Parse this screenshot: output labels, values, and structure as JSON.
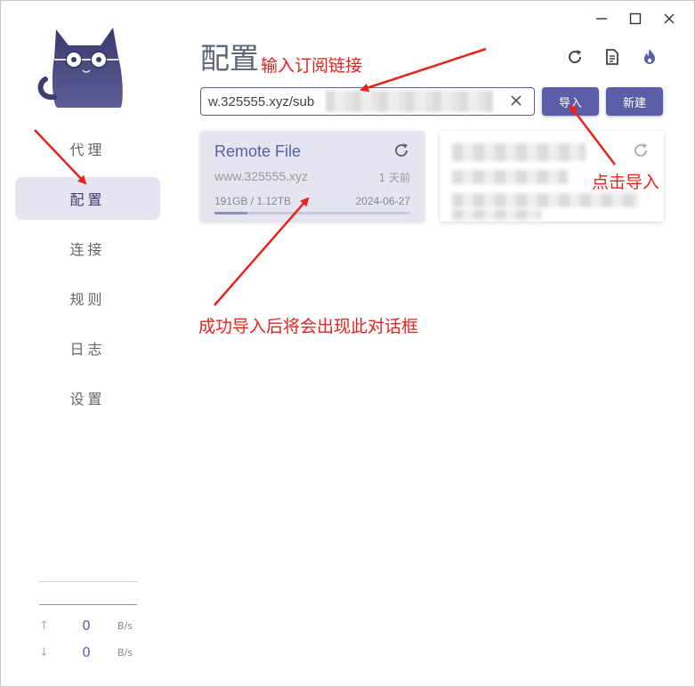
{
  "window": {
    "controls": [
      "minimize",
      "maximize",
      "close"
    ]
  },
  "sidebar": {
    "items": [
      {
        "label": "代理",
        "active": false
      },
      {
        "label": "配置",
        "active": true
      },
      {
        "label": "连接",
        "active": false
      },
      {
        "label": "规则",
        "active": false
      },
      {
        "label": "日志",
        "active": false
      },
      {
        "label": "设置",
        "active": false
      }
    ],
    "traffic": {
      "up_value": "0",
      "up_unit": "B/s",
      "down_value": "0",
      "down_unit": "B/s"
    }
  },
  "main": {
    "title": "配置",
    "toolbar_icons": [
      "refresh-icon",
      "file-text-icon",
      "fire-icon"
    ],
    "url_input": {
      "value": "w.325555.xyz/sub"
    },
    "import_label": "导入",
    "new_label": "新建",
    "profiles": [
      {
        "name": "Remote File",
        "url": "www.325555.xyz",
        "updated": "1 天前",
        "usage": "191GB / 1.12TB",
        "expire": "2024-06-27",
        "usage_fraction": 0.17
      }
    ]
  },
  "annotations": {
    "input_hint": "输入订阅链接",
    "import_hint": "点击导入",
    "result_hint": "成功导入后将会出现此对话框"
  },
  "colors": {
    "accent": "#5b5ea6",
    "active_bg": "#e4e5f1",
    "annotation": "#e8221d"
  }
}
